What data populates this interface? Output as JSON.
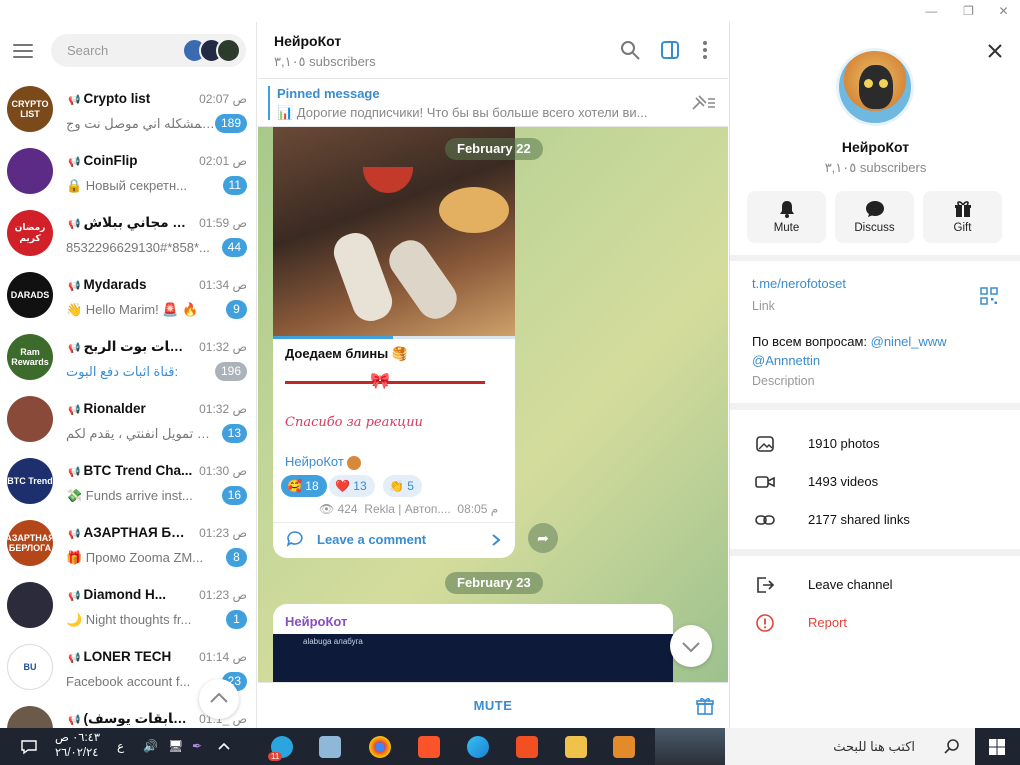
{
  "window": {
    "minimize": "—",
    "maximize": "❐",
    "close": "✕"
  },
  "search": {
    "placeholder": "Search"
  },
  "chats": [
    {
      "name": "Crypto list",
      "time": "02:07 ص",
      "preview": "المشكله اني موصل نت وج...",
      "badge": "189",
      "avatar_text": "CRYPTO LIST",
      "color": "#7a4a1a"
    },
    {
      "name": "CoinFlip",
      "time": "02:01 ص",
      "preview": "🔒 Новый секретн...",
      "badge": "11",
      "avatar_text": "",
      "color": "#5b2b86"
    },
    {
      "name": "نت مجاني ببلاش ...",
      "time": "01:59 ص",
      "preview": "8532296629130#*858*...",
      "badge": "44",
      "avatar_text": "رمضان كريم",
      "color": "#d12027"
    },
    {
      "name": "Mydarads",
      "time": "01:34 ص",
      "preview": "👋 Hello Marim! 🚨 🔥",
      "badge": "9",
      "avatar_text": "DARADS",
      "color": "#111111"
    },
    {
      "name": "شات بوت الربح ...E",
      "time": "01:32 ص",
      "preview": "قناة اثبات دفع البوت:",
      "badge": "196",
      "avatar_text": "Ram Rewards",
      "color": "#3d6b2b"
    },
    {
      "name": "Rionalder",
      "time": "01:32 ص",
      "preview": "بوت تمويل انفنتي ، يقدم لكم...",
      "badge": "13",
      "avatar_text": "",
      "color": "#8a4a3a"
    },
    {
      "name": "BTC Trend Cha...",
      "time": "01:30 ص",
      "preview": "💸 Funds arrive inst...",
      "badge": "16",
      "avatar_text": "BTC Trend",
      "color": "#1e2f6e"
    },
    {
      "name": "АЗАРТНАЯ БЕР...",
      "time": "01:23 ص",
      "preview": "🎁 Промо Zooma  ZM...",
      "badge": "8",
      "avatar_text": "АЗАРТНАЯ БЕРЛОГА",
      "color": "#b4471a"
    },
    {
      "name": "Diamond H...",
      "time": "01:23 ص",
      "preview": "🌙 Night thoughts fr...",
      "badge": "1",
      "avatar_text": "",
      "color": "#2b2b3b"
    },
    {
      "name": "LONER TECH",
      "time": "01:14 ص",
      "preview": "Facebook account f...",
      "badge": "23",
      "avatar_text": "BU",
      "color": "#ffffff"
    },
    {
      "name": "(مسابقات يوسف )",
      "time": "01:1_ ص",
      "preview": "",
      "badge": "",
      "avatar_text": "",
      "color": "#6b5a4a"
    }
  ],
  "channel": {
    "title": "НейроКот",
    "subscribers": "٣,١٠٥ subscribers",
    "pinned_label": "Pinned message",
    "pinned_text": "📊 Дорогие подписчики! Что бы вы больше всего хотели ви...",
    "date1": "February 22",
    "date2": "February 23",
    "post_title": "Доедаем блины 🥞",
    "post_script": "Спасибо за реакции",
    "post_author": "НейроКот",
    "reactions": [
      {
        "emoji": "🥰",
        "count": "18"
      },
      {
        "emoji": "❤️",
        "count": "13"
      },
      {
        "emoji": "👏",
        "count": "5"
      }
    ],
    "views": "424",
    "signature": "Rekla | Автоп....",
    "post_time": "08:05 م",
    "leave_comment": "Leave a comment",
    "post2_author": "НейроКот",
    "post2_logo": "alabuga  алабуга",
    "mute": "MUTE"
  },
  "profile": {
    "name": "НейроКот",
    "subscribers": "٣,١٠٥ subscribers",
    "buttons": {
      "mute": "Mute",
      "discuss": "Discuss",
      "gift": "Gift"
    },
    "link": "t.me/nerofotoset",
    "link_label": "Link",
    "desc_prefix": "По всем вопросам:",
    "desc_user1": "@ninel_www",
    "desc_user2": "@Annnettin",
    "desc_label": "Description",
    "photos": "1910 photos",
    "videos": "1493 videos",
    "links": "2177 shared links",
    "leave": "Leave channel",
    "report": "Report"
  },
  "taskbar": {
    "search_text": "اكتب هنا للبحث",
    "time": "٠٦:٤٣ ص",
    "date": "٢٦/٠٢/٢٤",
    "lang": "ع",
    "telegram_badge": "11"
  }
}
